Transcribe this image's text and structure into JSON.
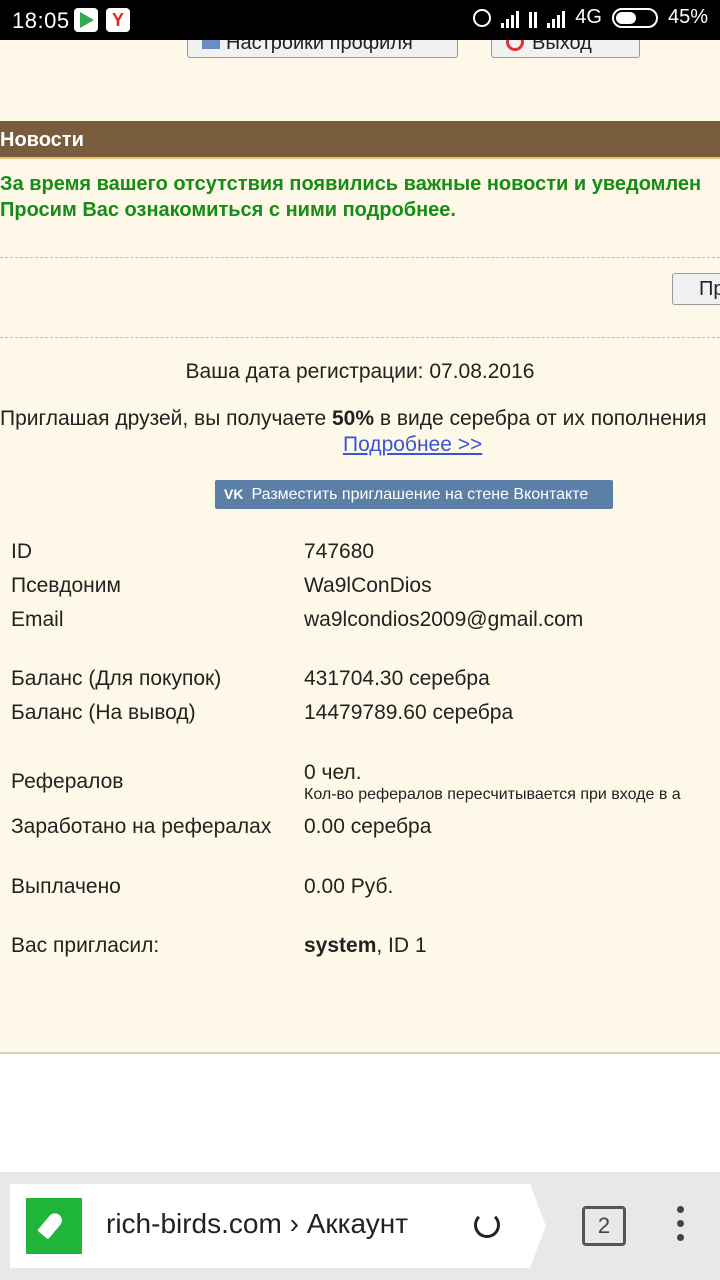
{
  "status_bar": {
    "time": "18:05",
    "network": "4G",
    "battery": "45%"
  },
  "page": {
    "buttons": {
      "settings": "Настройки профиля",
      "logout": "Выход"
    },
    "news": {
      "header": "Новости",
      "line1": "За время вашего отсутствия появились важные новости и уведомлен",
      "line2": "Просим Вас ознакомиться с ними подробнее.",
      "more_button": "Пр"
    },
    "registration": "Ваша дата регистрации: 07.08.2016",
    "invite": {
      "before": "Приглашая друзей, вы получаете ",
      "percent": "50%",
      "after": " в виде серебра от их пополнения",
      "more_link": "Подробнее >>"
    },
    "vk_button": {
      "icon": "vk-icon",
      "label": "Разместить приглашение на стене Вконтакте"
    },
    "account": {
      "id_label": "ID",
      "id_value": "747680",
      "nick_label": "Псевдоним",
      "nick_value": "Wa9lConDios",
      "email_label": "Email",
      "email_value": "wa9lcondios2009@gmail.com",
      "balance_buy_label": "Баланс (Для покупок)",
      "balance_buy_value": "431704.30 серебра",
      "balance_out_label": "Баланс (На вывод)",
      "balance_out_value": "14479789.60 серебра",
      "referrals_label": "Рефералов",
      "referrals_value": "0 чел.",
      "referrals_note": "Кол-во рефералов пересчитывается при входе в а",
      "earned_label": "Заработано на рефералах",
      "earned_value": "0.00 серебра",
      "paid_label": "Выплачено",
      "paid_value": "0.00 Руб.",
      "invited_label": "Вас пригласил:",
      "invited_name": "system",
      "invited_id": ", ID 1"
    }
  },
  "browser": {
    "url": "rich-birds.com › Аккаунт",
    "tabs_count": "2"
  }
}
